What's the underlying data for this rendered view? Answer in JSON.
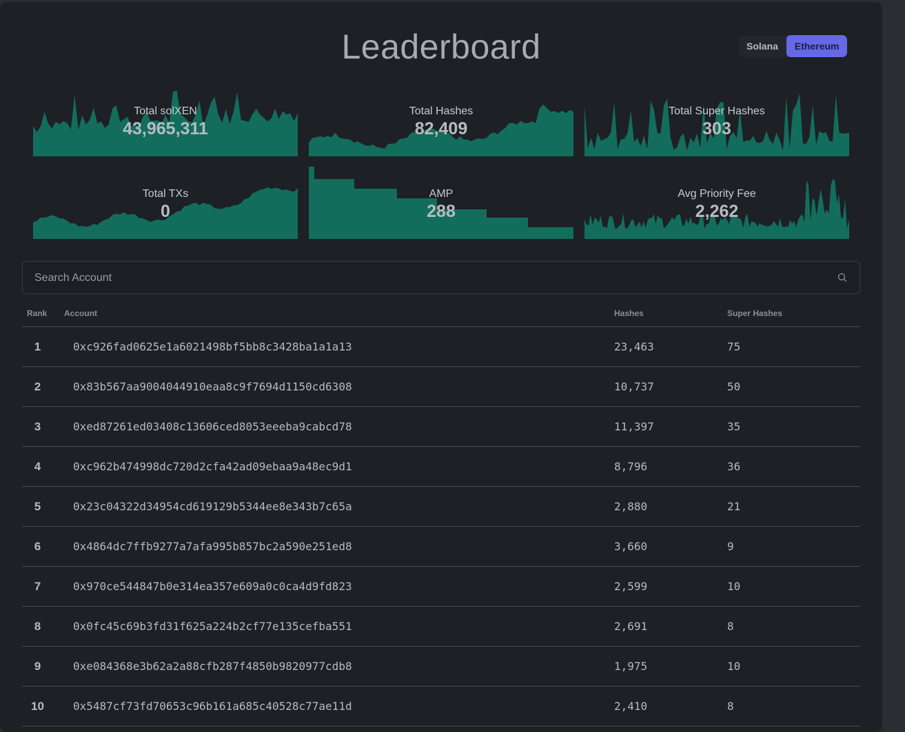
{
  "header": {
    "title": "Leaderboard",
    "chains": [
      "Solana",
      "Ethereum"
    ],
    "active_chain": "Ethereum",
    "accent_color": "#6569e6"
  },
  "stats": [
    {
      "label": "Total solXEN",
      "value": "43,965,311"
    },
    {
      "label": "Total Hashes",
      "value": "82,409"
    },
    {
      "label": "Total Super Hashes",
      "value": "303"
    },
    {
      "label": "Total TXs",
      "value": "0"
    },
    {
      "label": "AMP",
      "value": "288"
    },
    {
      "label": "Avg Priority Fee",
      "value": "2,262"
    }
  ],
  "chart_color": "#136d5d",
  "search": {
    "placeholder": "Search Account",
    "value": "",
    "icon": "search-icon"
  },
  "table": {
    "headers": {
      "rank": "Rank",
      "account": "Account",
      "hashes": "Hashes",
      "super_hashes": "Super Hashes"
    },
    "rows": [
      {
        "rank": "1",
        "account": "0xc926fad0625e1a6021498bf5bb8c3428ba1a1a13",
        "hashes": "23,463",
        "super_hashes": "75"
      },
      {
        "rank": "2",
        "account": "0x83b567aa9004044910eaa8c9f7694d1150cd6308",
        "hashes": "10,737",
        "super_hashes": "50"
      },
      {
        "rank": "3",
        "account": "0xed87261ed03408c13606ced8053eeeba9cabcd78",
        "hashes": "11,397",
        "super_hashes": "35"
      },
      {
        "rank": "4",
        "account": "0xc962b474998dc720d2cfa42ad09ebaa9a48ec9d1",
        "hashes": "8,796",
        "super_hashes": "36"
      },
      {
        "rank": "5",
        "account": "0x23c04322d34954cd619129b5344ee8e343b7c65a",
        "hashes": "2,880",
        "super_hashes": "21"
      },
      {
        "rank": "6",
        "account": "0x4864dc7ffb9277a7afa995b857bc2a590e251ed8",
        "hashes": "3,660",
        "super_hashes": "9"
      },
      {
        "rank": "7",
        "account": "0x970ce544847b0e314ea357e609a0c0ca4d9fd823",
        "hashes": "2,599",
        "super_hashes": "10"
      },
      {
        "rank": "8",
        "account": "0x0fc45c69b3fd31f625a224b2cf77e135cefba551",
        "hashes": "2,691",
        "super_hashes": "8"
      },
      {
        "rank": "9",
        "account": "0xe084368e3b62a2a88cfb287f4850b9820977cdb8",
        "hashes": "1,975",
        "super_hashes": "10"
      },
      {
        "rank": "10",
        "account": "0x5487cf73fd70653c96b161a685c40528c77ae11d",
        "hashes": "2,410",
        "super_hashes": "8"
      }
    ]
  }
}
